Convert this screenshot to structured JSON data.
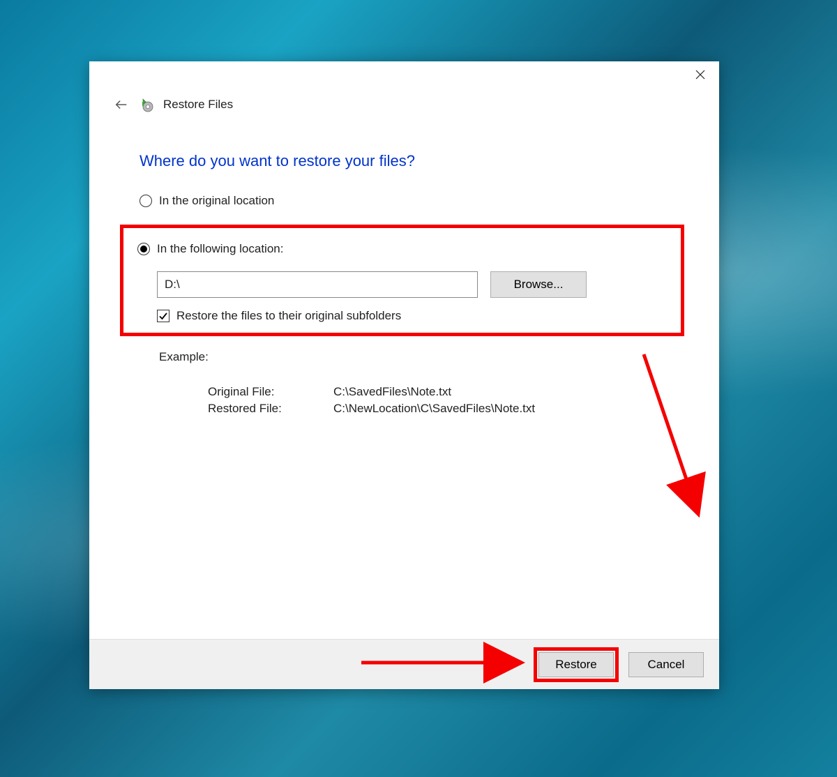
{
  "window": {
    "title": "Restore Files"
  },
  "heading": "Where do you want to restore your files?",
  "options": {
    "original_location_label": "In the original location",
    "following_location_label": "In the following location:"
  },
  "location": {
    "path_value": "D:\\",
    "browse_label": "Browse..."
  },
  "subfolders_checkbox": {
    "label": "Restore the files to their original subfolders",
    "checked": true
  },
  "example": {
    "label": "Example:",
    "original_file_label": "Original File:",
    "original_file_value": "C:\\SavedFiles\\Note.txt",
    "restored_file_label": "Restored File:",
    "restored_file_value": "C:\\NewLocation\\C\\SavedFiles\\Note.txt"
  },
  "footer": {
    "restore_label": "Restore",
    "cancel_label": "Cancel"
  }
}
